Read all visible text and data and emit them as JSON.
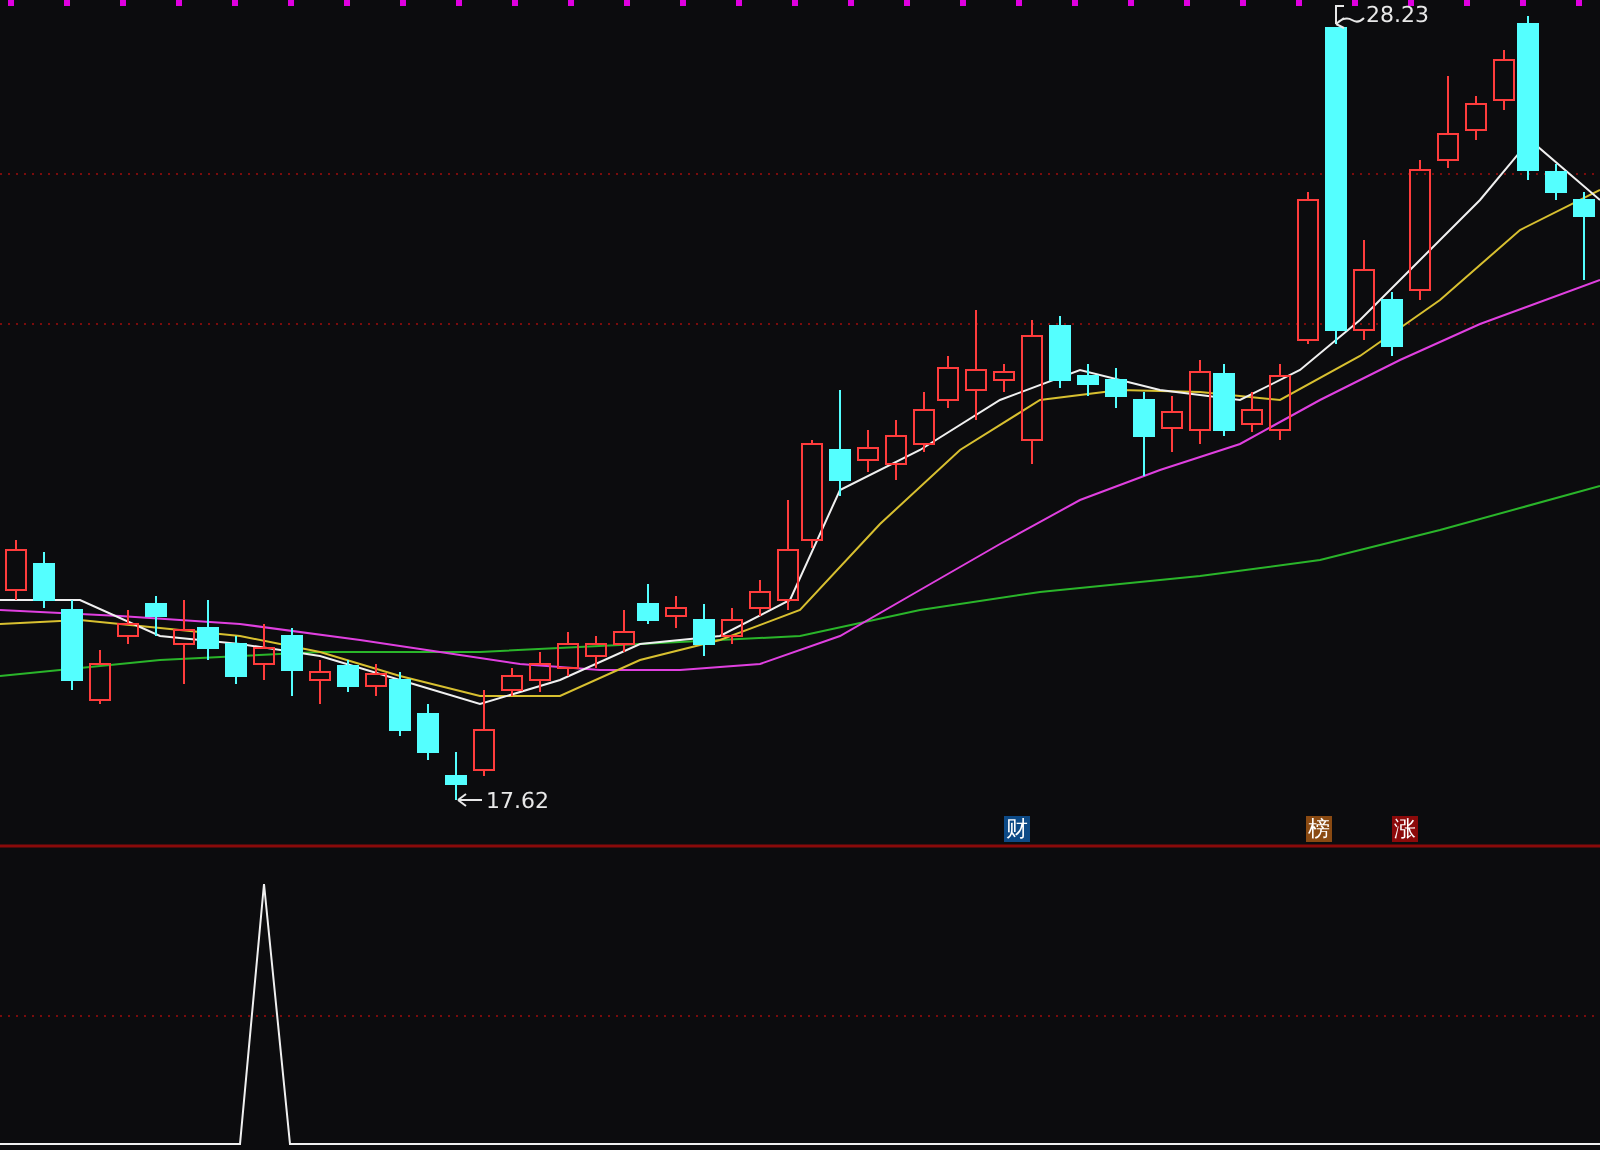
{
  "price_chart": {
    "high_label": "28.23",
    "low_label": "17.62"
  },
  "event_badges": [
    {
      "text": "财",
      "color": "#0d4a86"
    },
    {
      "text": "榜",
      "color": "#8a4a12"
    },
    {
      "text": "涨",
      "color": "#8c0a0a"
    }
  ]
}
